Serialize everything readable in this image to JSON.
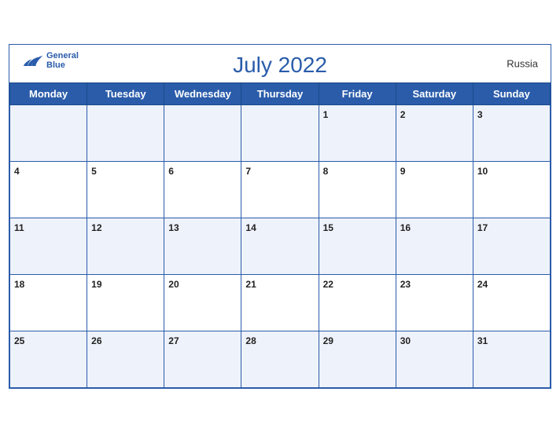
{
  "header": {
    "title": "July 2022",
    "country": "Russia",
    "logo_general": "General",
    "logo_blue": "Blue"
  },
  "weekdays": [
    "Monday",
    "Tuesday",
    "Wednesday",
    "Thursday",
    "Friday",
    "Saturday",
    "Sunday"
  ],
  "weeks": [
    [
      {
        "date": "",
        "label": ""
      },
      {
        "date": "",
        "label": ""
      },
      {
        "date": "",
        "label": ""
      },
      {
        "date": "",
        "label": ""
      },
      {
        "date": "1",
        "label": "1"
      },
      {
        "date": "2",
        "label": "2"
      },
      {
        "date": "3",
        "label": "3"
      }
    ],
    [
      {
        "date": "4",
        "label": "4"
      },
      {
        "date": "5",
        "label": "5"
      },
      {
        "date": "6",
        "label": "6"
      },
      {
        "date": "7",
        "label": "7"
      },
      {
        "date": "8",
        "label": "8"
      },
      {
        "date": "9",
        "label": "9"
      },
      {
        "date": "10",
        "label": "10"
      }
    ],
    [
      {
        "date": "11",
        "label": "11"
      },
      {
        "date": "12",
        "label": "12"
      },
      {
        "date": "13",
        "label": "13"
      },
      {
        "date": "14",
        "label": "14"
      },
      {
        "date": "15",
        "label": "15"
      },
      {
        "date": "16",
        "label": "16"
      },
      {
        "date": "17",
        "label": "17"
      }
    ],
    [
      {
        "date": "18",
        "label": "18"
      },
      {
        "date": "19",
        "label": "19"
      },
      {
        "date": "20",
        "label": "20"
      },
      {
        "date": "21",
        "label": "21"
      },
      {
        "date": "22",
        "label": "22"
      },
      {
        "date": "23",
        "label": "23"
      },
      {
        "date": "24",
        "label": "24"
      }
    ],
    [
      {
        "date": "25",
        "label": "25"
      },
      {
        "date": "26",
        "label": "26"
      },
      {
        "date": "27",
        "label": "27"
      },
      {
        "date": "28",
        "label": "28"
      },
      {
        "date": "29",
        "label": "29"
      },
      {
        "date": "30",
        "label": "30"
      },
      {
        "date": "31",
        "label": "31"
      }
    ]
  ]
}
